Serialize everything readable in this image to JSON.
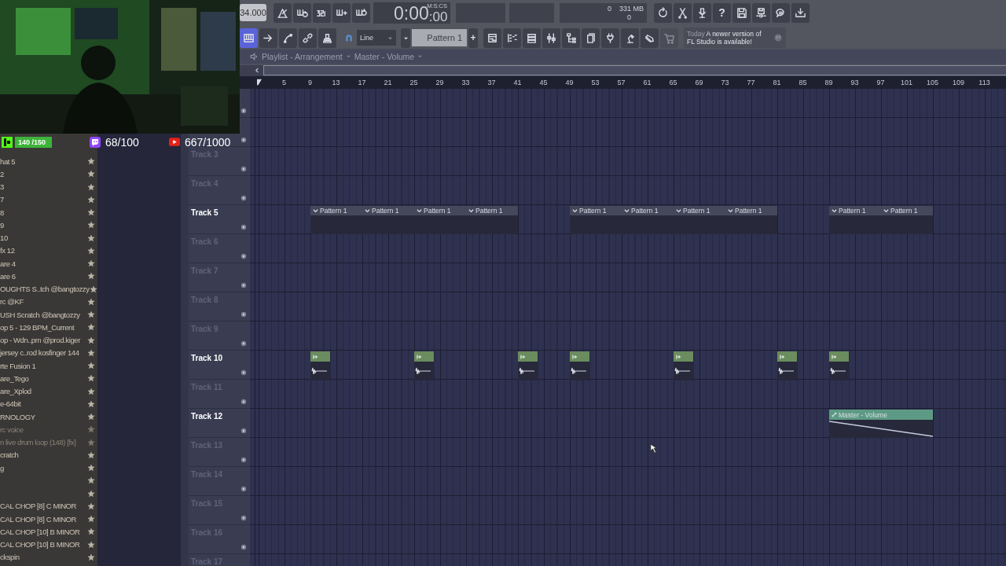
{
  "stream_stats": {
    "follower_goal": "140 /150",
    "twitch_goal": "68/100",
    "youtube_goal": "667/1000"
  },
  "toolbar": {
    "tempo": "34.000",
    "time": "0:00",
    "time_fraction": ":00",
    "time_unit": "M:S:CS",
    "cpu_value": "0",
    "memory": "331 MB",
    "polyphony": "0",
    "help_label": "?",
    "tools": [
      {
        "selected": true
      },
      {
        "selected": false
      },
      {
        "selected": false
      },
      {
        "selected": false
      },
      {
        "selected": false
      }
    ],
    "snap_mode": "Line",
    "pattern": "Pattern 1",
    "add_label": "+",
    "right_tools": [
      {
        "disabled": false
      },
      {
        "disabled": false
      },
      {
        "disabled": false
      },
      {
        "disabled": false
      },
      {
        "disabled": false
      },
      {
        "disabled": false
      },
      {
        "disabled": false
      },
      {
        "disabled": false
      },
      {
        "disabled": false
      },
      {
        "disabled": true
      }
    ],
    "hint": {
      "prefix": "Today",
      "text": "A newer version of FL Studio is available!"
    }
  },
  "playlist": {
    "title": "Playlist - Arrangement",
    "target": "Master - Volume",
    "ruler": [
      "5",
      "9",
      "13",
      "17",
      "21",
      "25",
      "29",
      "33",
      "37",
      "41",
      "45",
      "49",
      "53",
      "57",
      "61",
      "65",
      "69",
      "73",
      "77",
      "81",
      "85",
      "89",
      "93",
      "97",
      "101",
      "105",
      "109",
      "113"
    ],
    "tracks": [
      {
        "label": "Track 3",
        "active": false
      },
      {
        "label": "Track 4",
        "active": false
      },
      {
        "label": "Track 5",
        "active": true,
        "clips": [
          {
            "kind": "pattern",
            "label": "Pattern 1"
          },
          {
            "kind": "pattern",
            "label": "Pattern 1"
          },
          {
            "kind": "pattern",
            "label": "Pattern 1"
          },
          {
            "kind": "pattern",
            "label": "Pattern 1"
          },
          {
            "kind": "pattern",
            "label": "Pattern 1"
          },
          {
            "kind": "pattern",
            "label": "Pattern 1"
          },
          {
            "kind": "pattern",
            "label": "Pattern 1"
          },
          {
            "kind": "pattern",
            "label": "Pattern 1"
          },
          {
            "kind": "pattern",
            "label": "Pattern 1"
          },
          {
            "kind": "pattern",
            "label": "Pattern 1"
          }
        ]
      },
      {
        "label": "Track 6",
        "active": false
      },
      {
        "label": "Track 7",
        "active": false
      },
      {
        "label": "Track 8",
        "active": false
      },
      {
        "label": "Track 9",
        "active": false
      },
      {
        "label": "Track 10",
        "active": true,
        "clips": [
          {
            "kind": "audio"
          },
          {
            "kind": "audio"
          },
          {
            "kind": "audio"
          },
          {
            "kind": "audio"
          },
          {
            "kind": "audio"
          },
          {
            "kind": "audio"
          },
          {
            "kind": "audio"
          }
        ]
      },
      {
        "label": "Track 11",
        "active": false
      },
      {
        "label": "Track 12",
        "active": true,
        "clips": [
          {
            "kind": "automation",
            "label": "Master - Volume"
          }
        ]
      },
      {
        "label": "Track 13",
        "active": false
      },
      {
        "label": "Track 14",
        "active": false
      },
      {
        "label": "Track 15",
        "active": false
      },
      {
        "label": "Track 16",
        "active": false
      },
      {
        "label": "Track 17",
        "active": false
      }
    ]
  },
  "browser": {
    "items": [
      {
        "label": "hat 5",
        "dimmed": false
      },
      {
        "label": "2",
        "dimmed": false
      },
      {
        "label": "3",
        "dimmed": false
      },
      {
        "label": "7",
        "dimmed": false
      },
      {
        "label": "8",
        "dimmed": false
      },
      {
        "label": "9",
        "dimmed": false
      },
      {
        "label": "10",
        "dimmed": false
      },
      {
        "label": "fx 12",
        "dimmed": false
      },
      {
        "label": "are 4",
        "dimmed": false
      },
      {
        "label": "are 6",
        "dimmed": false
      },
      {
        "label": "OUGHTS S..tch @bangtozzy",
        "dimmed": false
      },
      {
        "label": "rc @KF",
        "dimmed": false
      },
      {
        "label": "USH Scratch @bangtozzy",
        "dimmed": false
      },
      {
        "label": "op 5 - 129 BPM_Current",
        "dimmed": false
      },
      {
        "label": "op - Wdn..pm @prod.kiger",
        "dimmed": false
      },
      {
        "label": "jersey c..rod kosfinger 144",
        "dimmed": false
      },
      {
        "label": "rte Fusion 1",
        "dimmed": false
      },
      {
        "label": "are_Tego",
        "dimmed": false
      },
      {
        "label": "are_Xplod",
        "dimmed": false
      },
      {
        "label": "e-64bit",
        "dimmed": false
      },
      {
        "label": "RNOLOGY",
        "dimmed": false
      },
      {
        "label": "rc voice",
        "dimmed": true
      },
      {
        "label": "n live drum loop (148) [fx]",
        "dimmed": true
      },
      {
        "label": "cratch",
        "dimmed": false
      },
      {
        "label": "g",
        "dimmed": false
      },
      {
        "dimmed": false
      },
      {
        "dimmed": false
      },
      {
        "label": "CAL CHOP [8] C MINOR",
        "dimmed": false
      },
      {
        "label": "CAL CHOP [8] C MINOR",
        "dimmed": false
      },
      {
        "label": "CAL CHOP [10] B MINOR",
        "dimmed": false
      },
      {
        "label": "CAL CHOP [10] B MINOR",
        "dimmed": false
      },
      {
        "label": "ckspin",
        "dimmed": false
      }
    ]
  }
}
